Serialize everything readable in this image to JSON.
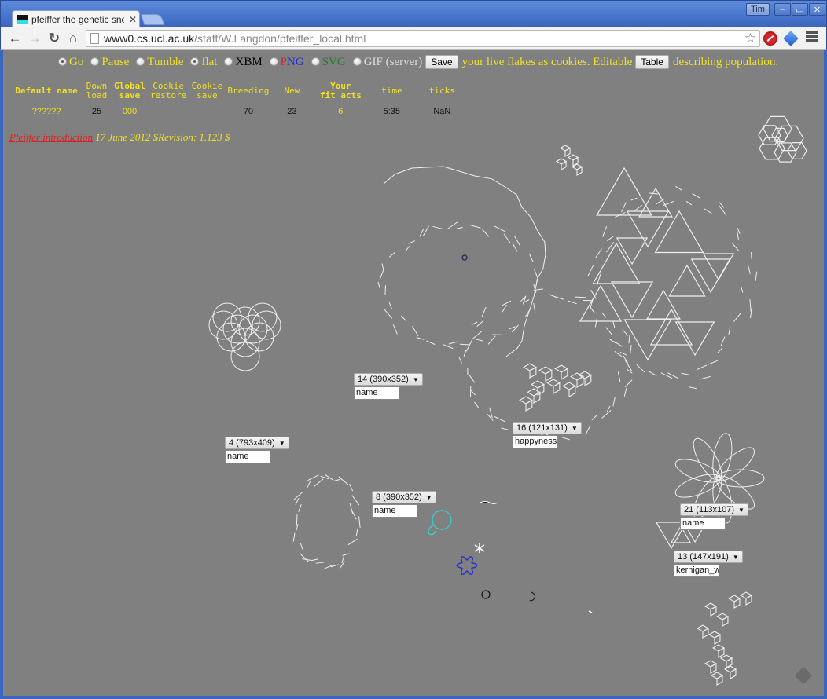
{
  "window": {
    "tab_title": "pfeiffer the genetic snowflake",
    "tab_title_visible": "pfeiffer the genetic snow",
    "user": "Tim"
  },
  "toolbar": {
    "url_host": "www0.cs.ucl.ac.uk",
    "url_path": "/staff/W.Langdon/pfeiffer_local.html"
  },
  "controls": {
    "modes": [
      {
        "label": "Go",
        "selected": true
      },
      {
        "label": "Pause",
        "selected": false
      },
      {
        "label": "Tumble",
        "selected": false
      }
    ],
    "flat": {
      "label": "flat",
      "selected": true
    },
    "formats": [
      {
        "label": "XBM",
        "selected": false
      },
      {
        "label_p": "P",
        "label_n": "N",
        "label_g": "G",
        "selected": false
      },
      {
        "label": "SVG",
        "selected": false
      },
      {
        "label": "GIF (server)",
        "selected": false
      }
    ],
    "save_button": "Save",
    "save_text": "your live flakes as cookies. Editable",
    "table_button": "Table",
    "table_text": "describing population.",
    "colors": {
      "yellow": "#f0e020",
      "png_p": "#e02020",
      "png_ng": "#2030d0",
      "svg": "#208020",
      "xbm": "#000000"
    }
  },
  "stats": {
    "headers": [
      {
        "l1": "Default name",
        "l2": "",
        "bold": true
      },
      {
        "l1": "Down",
        "l2": "load",
        "bold": false
      },
      {
        "l1": "Global",
        "l2": "save",
        "bold": true
      },
      {
        "l1": "Cookie",
        "l2": "restore",
        "bold": false
      },
      {
        "l1": "Cookie",
        "l2": "save",
        "bold": false
      },
      {
        "l1": "Breeding",
        "l2": "",
        "bold": false
      },
      {
        "l1": "New",
        "l2": "",
        "bold": false
      },
      {
        "l1": "Your",
        "l2": "fit acts",
        "bold": true
      },
      {
        "l1": "time",
        "l2": "",
        "bold": false
      },
      {
        "l1": "ticks",
        "l2": "",
        "bold": false
      }
    ],
    "values": [
      "??????",
      "25",
      "000",
      "",
      "",
      "70",
      "23",
      "6",
      "5:35",
      "NaN"
    ]
  },
  "intro": {
    "link": "Pfeiffer introduction",
    "text": "17 June 2012 $Revision: 1.123 $"
  },
  "flakes": [
    {
      "id": "14",
      "size": "390x352",
      "label": "14 (390x352)",
      "name": "name"
    },
    {
      "id": "4",
      "size": "793x409",
      "label": "4 (793x409)",
      "name": "name"
    },
    {
      "id": "16",
      "size": "121x131",
      "label": "16 (121x131)",
      "name": "happyness"
    },
    {
      "id": "8",
      "size": "390x352",
      "label": "8 (390x352)",
      "name": "name"
    },
    {
      "id": "21",
      "size": "113x107",
      "label": "21 (113x107)",
      "name": "name"
    },
    {
      "id": "13",
      "size": "147x191",
      "label": "13 (147x191)",
      "name": "kernigan_w"
    }
  ]
}
